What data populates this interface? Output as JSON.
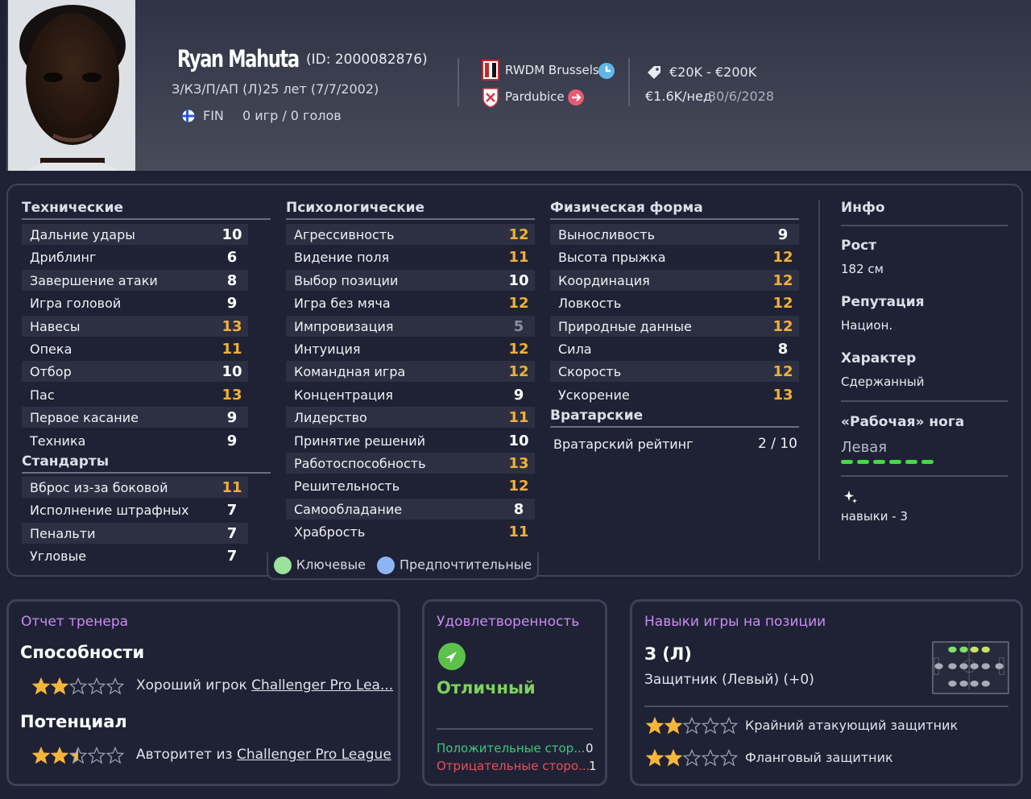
{
  "player": {
    "name": "Ryan Mahuta",
    "id_text": "(ID: 2000082876)",
    "positions": "З/КЗ/П/АП (Л)",
    "age": "25 лет (7/7/2002)",
    "nationality": "FIN",
    "apps": "0 игр / 0 голов"
  },
  "clubs": {
    "current": "RWDM Brussels",
    "loan": "Pardubice"
  },
  "contract": {
    "value_range": "€20K - €200K",
    "wage": "€1.6K/нед",
    "expiry": "30/6/2028"
  },
  "technical": {
    "title": "Технические",
    "rows": [
      {
        "label": "Дальние удары",
        "value": "10"
      },
      {
        "label": "Дриблинг",
        "value": "6"
      },
      {
        "label": "Завершение атаки",
        "value": "8"
      },
      {
        "label": "Игра головой",
        "value": "9"
      },
      {
        "label": "Навесы",
        "value": "13"
      },
      {
        "label": "Опека",
        "value": "11"
      },
      {
        "label": "Отбор",
        "value": "10"
      },
      {
        "label": "Пас",
        "value": "13"
      },
      {
        "label": "Первое касание",
        "value": "9"
      },
      {
        "label": "Техника",
        "value": "9"
      }
    ]
  },
  "set_pieces": {
    "title": "Стандарты",
    "rows": [
      {
        "label": "Вброс из-за боковой",
        "value": "11"
      },
      {
        "label": "Исполнение штрафных",
        "value": "7"
      },
      {
        "label": "Пенальти",
        "value": "7"
      },
      {
        "label": "Угловые",
        "value": "7"
      }
    ]
  },
  "mental": {
    "title": "Психологические",
    "rows": [
      {
        "label": "Агрессивность",
        "value": "12"
      },
      {
        "label": "Видение поля",
        "value": "11"
      },
      {
        "label": "Выбор позиции",
        "value": "10"
      },
      {
        "label": "Игра без мяча",
        "value": "12"
      },
      {
        "label": "Импровизация",
        "value": "5"
      },
      {
        "label": "Интуиция",
        "value": "12"
      },
      {
        "label": "Командная игра",
        "value": "12"
      },
      {
        "label": "Концентрация",
        "value": "9"
      },
      {
        "label": "Лидерство",
        "value": "11"
      },
      {
        "label": "Принятие решений",
        "value": "10"
      },
      {
        "label": "Работоспособность",
        "value": "13"
      },
      {
        "label": "Решительность",
        "value": "12"
      },
      {
        "label": "Самообладание",
        "value": "8"
      },
      {
        "label": "Храбрость",
        "value": "11"
      }
    ]
  },
  "physical": {
    "title": "Физическая форма",
    "rows": [
      {
        "label": "Выносливость",
        "value": "9"
      },
      {
        "label": "Высота прыжка",
        "value": "12"
      },
      {
        "label": "Координация",
        "value": "12"
      },
      {
        "label": "Ловкость",
        "value": "12"
      },
      {
        "label": "Природные данные",
        "value": "12"
      },
      {
        "label": "Сила",
        "value": "8"
      },
      {
        "label": "Скорость",
        "value": "12"
      },
      {
        "label": "Ускорение",
        "value": "13"
      }
    ]
  },
  "goalkeeping": {
    "title": "Вратарские",
    "label": "Вратарский рейтинг",
    "value": "2 / 10"
  },
  "legend": {
    "key": "Ключевые",
    "preferred": "Предпочтительные",
    "key_color": "#9be39b",
    "preferred_color": "#8fb4f5"
  },
  "info": {
    "title": "Инфо",
    "height_label": "Рост",
    "height_value": "182 см",
    "reputation_label": "Репутация",
    "reputation_value": "Национ.",
    "personality_label": "Характер",
    "personality_value": "Сдержанный",
    "foot_label": "«Рабочая» нога",
    "foot_value": "Левая",
    "skills_text": "навыки - 3"
  },
  "report": {
    "title": "Отчет тренера",
    "ability_label": "Способности",
    "ability_text": "Хороший игрок ",
    "ability_league": "Challenger Pro Lea...",
    "ability_stars": 2,
    "potential_label": "Потенциал",
    "potential_text": "Авторитет из ",
    "potential_league": "Challenger Pro League",
    "potential_stars": 2.5
  },
  "satisfaction": {
    "title": "Удовлетворенность",
    "status": "Отличный",
    "positive_label": "Положительные стор...",
    "positive_count": "0",
    "negative_label": "Отрицательные сторо...",
    "negative_count": "1"
  },
  "positions": {
    "title": "Навыки игры на позиции",
    "main": "З (Л)",
    "sub": "Защитник (Левый) (+0)",
    "roles": [
      {
        "label": "Крайний атакующий защитник",
        "stars": 2
      },
      {
        "label": "Фланговый защитник",
        "stars": 2
      }
    ]
  },
  "colors": {
    "accent_purple": "#c88cf0",
    "highlight_yellow": "#f2b134",
    "foot_green": "#48d848",
    "star_gold": "#f4b63a"
  }
}
